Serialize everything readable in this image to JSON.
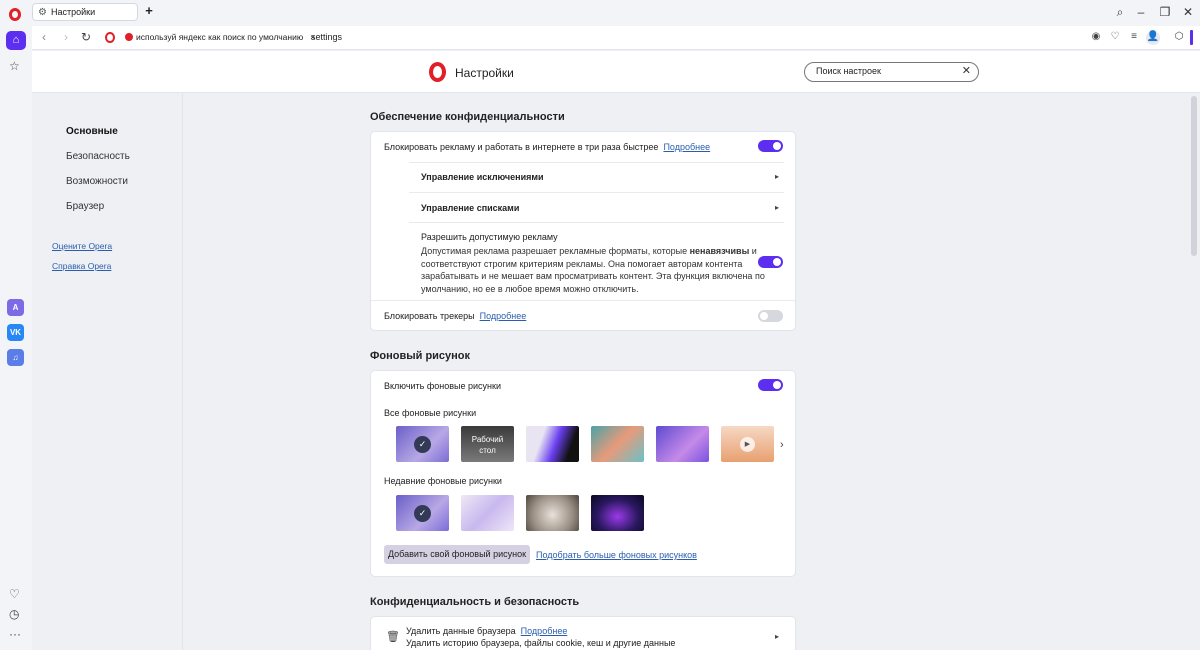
{
  "tabbar": {
    "tab_title": "Настройки",
    "new_tab": "+"
  },
  "addressbar": {
    "promo_text": "используй яндекс как поиск по умолчанию",
    "promo_close": "×",
    "url": "settings"
  },
  "header": {
    "title": "Настройки",
    "search_value": "Поиск настроек",
    "search_clear": "✕"
  },
  "leftnav": {
    "items": [
      "Основные",
      "Безопасность",
      "Возможности",
      "Браузер"
    ],
    "links": [
      "Оцените Opera",
      "Справка Opera"
    ]
  },
  "privacy": {
    "title": "Обеспечение конфиденциальности",
    "block_ads": "Блокировать рекламу и работать в интернете в три раза быстрее",
    "more": "Подробнее",
    "manage_exceptions": "Управление исключениями",
    "manage_lists": "Управление списками",
    "acceptable_ads_title": "Разрешить допустимую рекламу",
    "acceptable_ads_line1_a": "Допустимая реклама разрешает рекламные форматы, которые ",
    "acceptable_ads_line1_b": "ненавязчивы",
    "acceptable_ads_line1_c": " и",
    "acceptable_ads_line2": "соответствуют строгим критериям рекламы. Она помогает авторам контента",
    "acceptable_ads_line3": "зарабатывать и не мешает вам просматривать контент. Эта функция включена по",
    "acceptable_ads_line4": "умолчанию, но ее в любое время можно отключить.",
    "block_trackers": "Блокировать трекеры",
    "toggles": {
      "block_ads": true,
      "acceptable_ads": true,
      "block_trackers": false
    }
  },
  "wallpaper": {
    "title": "Фоновый рисунок",
    "enable": "Включить фоновые рисунки",
    "enabled": true,
    "all_label": "Все фоновые рисунки",
    "recent_label": "Недавние фоновые рисунки",
    "desktop_label_1": "Рабочий",
    "desktop_label_2": "стол",
    "add_button": "Добавить свой фоновый рисунок",
    "more_link": "Подобрать больше фоновых рисунков"
  },
  "security": {
    "title": "Конфиденциальность и безопасность",
    "delete_data": "Удалить данные браузера",
    "more": "Подробнее",
    "delete_desc": "Удалить историю браузера, файлы cookie, кеш и другие данные"
  },
  "colors": {
    "accent": "#5b2ef0",
    "opera_red": "#e01f27",
    "link": "#2a5db0"
  }
}
